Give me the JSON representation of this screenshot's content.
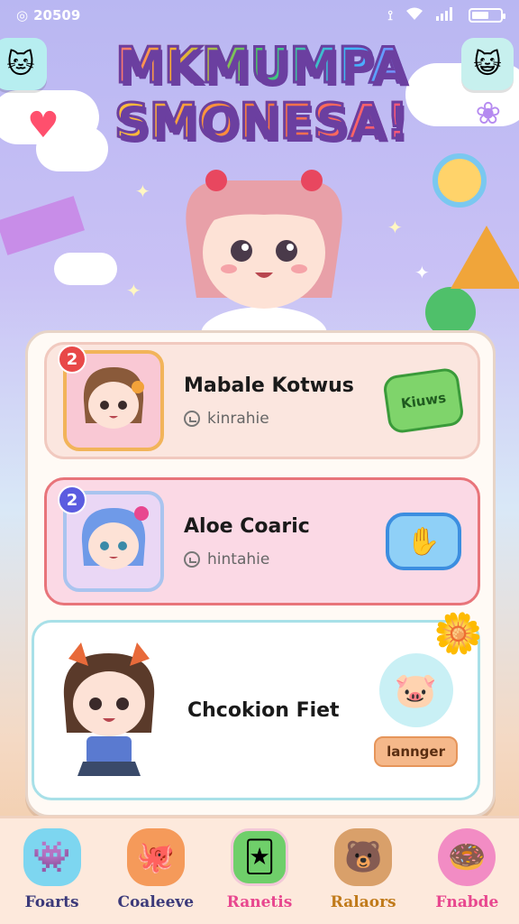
{
  "status": {
    "time": "20509",
    "left_icon": "app-indicator-icon",
    "battery_level": 0.6
  },
  "header": {
    "title_line1": "MKMUMPA",
    "title_line2": "SMONESA!",
    "left_button_icon": "cat-shield-icon",
    "right_button_icon": "happy-face-icon"
  },
  "cards": [
    {
      "rank": "2",
      "name": "Mabale Kotwus",
      "subtitle": "kinrahie",
      "action_label": "Kiuws",
      "accent": "#e84848"
    },
    {
      "rank": "2",
      "name": "Aloe Coaric",
      "subtitle": "hintahie",
      "action_icon": "hand-icon",
      "accent": "#5b5ce0"
    },
    {
      "name": "Chcokion Fiet",
      "action_label": "lannger",
      "side_icon": "pig-icon"
    }
  ],
  "nav": {
    "items": [
      {
        "label": "Foarts",
        "icon": "blob-monster-icon",
        "color": "#3c3a7a"
      },
      {
        "label": "Coaleeve",
        "icon": "orange-monster-icon",
        "color": "#3c3a7a"
      },
      {
        "label": "Ranetis",
        "icon": "green-card-icon",
        "color": "#e8478f",
        "active": true
      },
      {
        "label": "Ralaors",
        "icon": "bear-icon",
        "color": "#c07a1a"
      },
      {
        "label": "Fnabde",
        "icon": "donut-icon",
        "color": "#e8478f"
      }
    ]
  }
}
